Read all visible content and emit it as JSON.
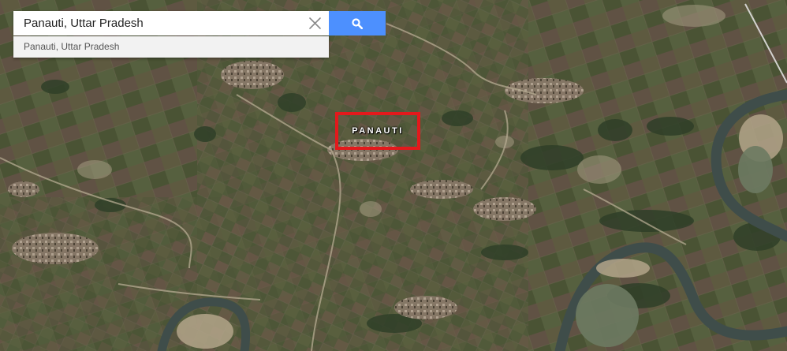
{
  "search": {
    "value": "Panauti, Uttar Pradesh",
    "placeholder": "",
    "clear_icon": "close-icon",
    "button_icon": "search-icon",
    "button_color": "#4d90fe"
  },
  "suggestions": [
    {
      "label": "Panauti, Uttar Pradesh"
    }
  ],
  "map": {
    "view": "satellite",
    "place_label": "PANAUTI",
    "marker_color": "#e3191c"
  }
}
